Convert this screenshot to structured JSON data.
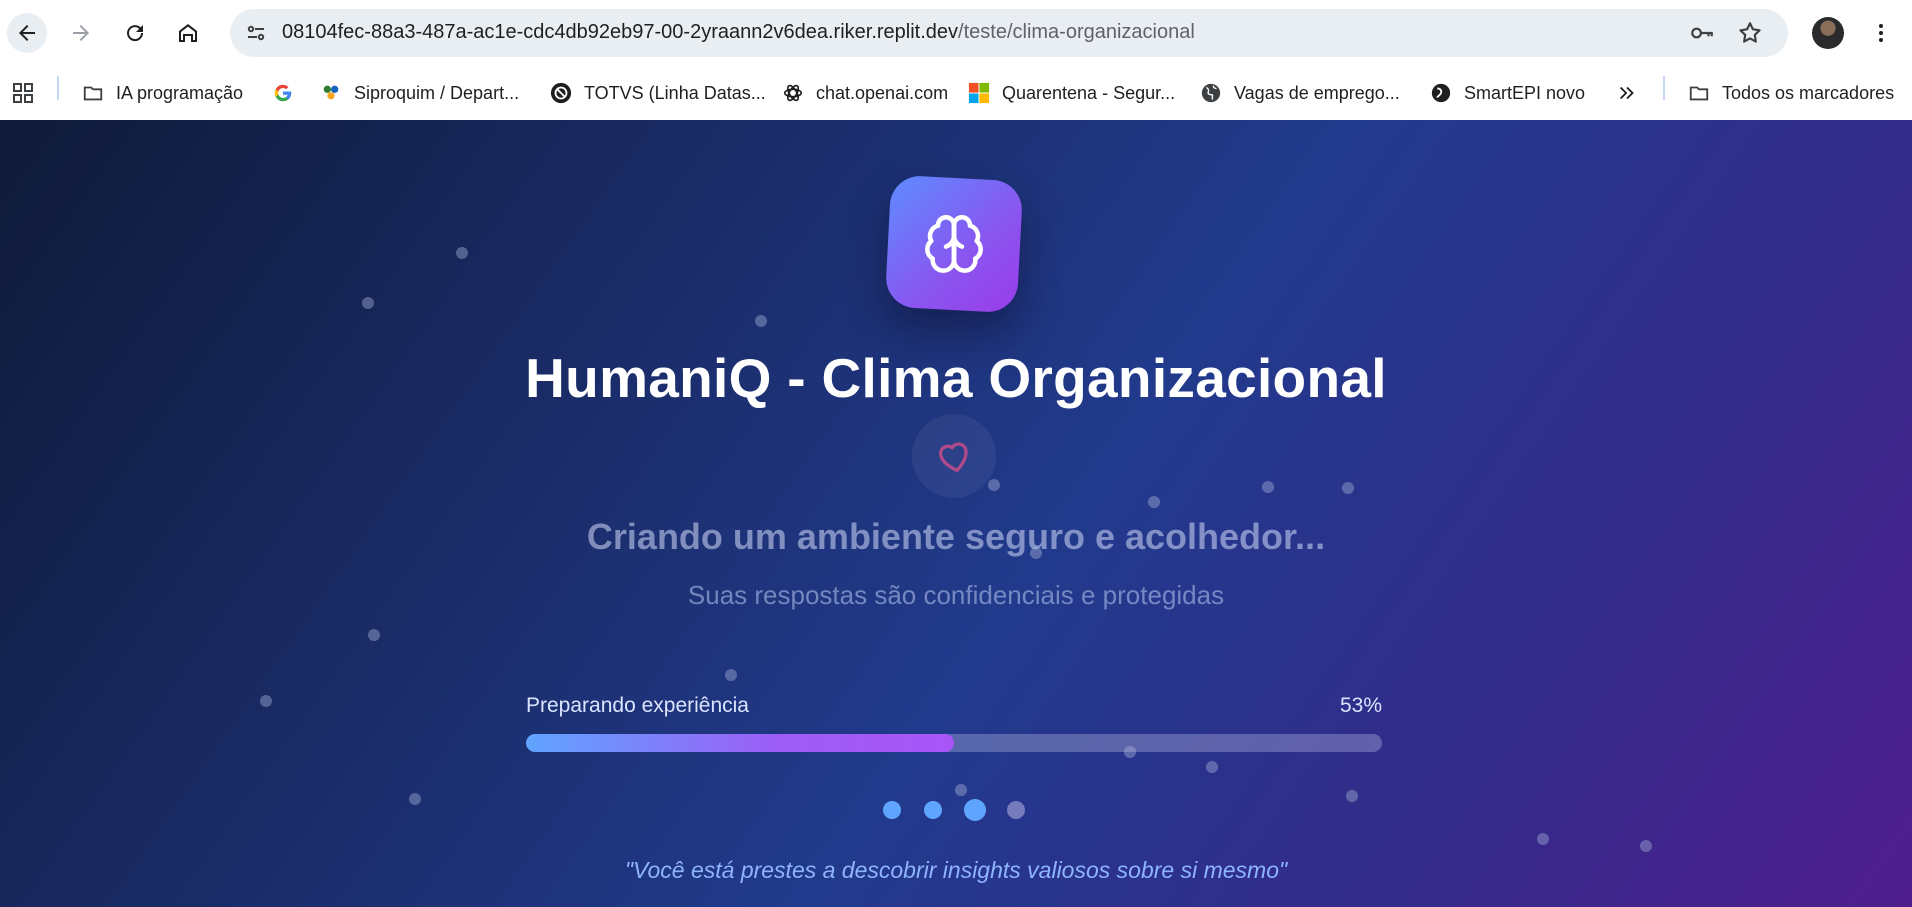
{
  "browser": {
    "url_host": "08104fec-88a3-487a-ac1e-cdc4db92eb97-00-2yraann2v6dea.riker.replit.dev",
    "url_path": "/teste/clima-organizacional",
    "bookmarks": [
      {
        "label": "IA programação",
        "icon": "folder-icon"
      },
      {
        "label": "",
        "icon": "google-icon"
      },
      {
        "label": "Siproquim / Depart...",
        "icon": "site-icon"
      },
      {
        "label": "TOTVS (Linha Datas...",
        "icon": "totvs-icon"
      },
      {
        "label": "chat.openai.com",
        "icon": "openai-icon"
      },
      {
        "label": "Quarentena - Segur...",
        "icon": "microsoft-icon"
      },
      {
        "label": "Vagas de emprego...",
        "icon": "globe-icon"
      },
      {
        "label": "SmartEPI novo",
        "icon": "smartepi-icon"
      }
    ],
    "all_bookmarks_label": "Todos os marcadores"
  },
  "page": {
    "title": "HumaniQ - Clima Organizacional",
    "subtitle": "Criando um ambiente seguro e acolhedor...",
    "description": "Suas respostas são confidenciais e protegidas",
    "progress_label": "Preparando experiência",
    "progress_percent_text": "53%",
    "progress_value": 0.5,
    "quote": "\"Você está prestes a descobrir insights valiosos sobre si mesmo\""
  },
  "colors": {
    "accent_blue": "#5fa5ff",
    "accent_purple": "#a855f7",
    "quote": "#8fb4ff"
  }
}
